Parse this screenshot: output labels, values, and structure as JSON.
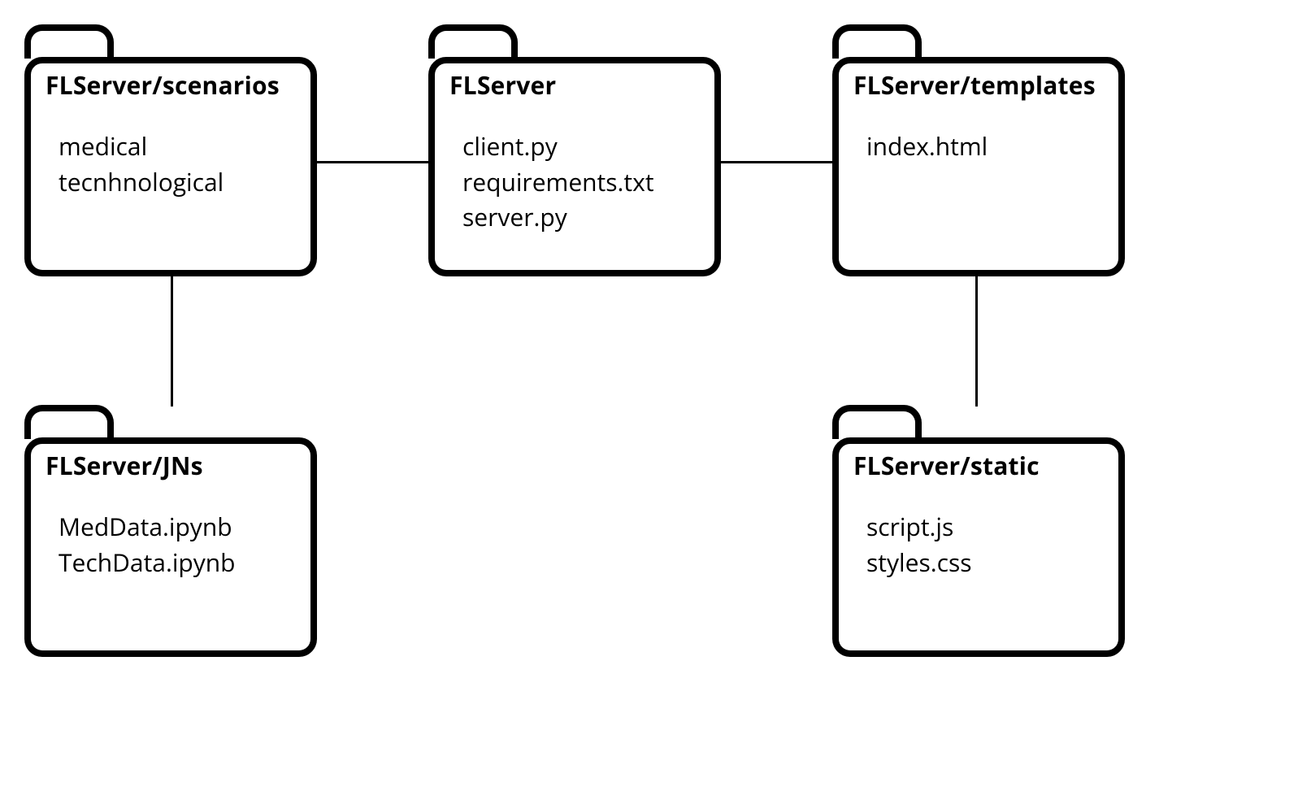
{
  "folders": {
    "scenarios": {
      "title": "FLServer/scenarios",
      "items": [
        "medical",
        "tecnhnological"
      ]
    },
    "flserver": {
      "title": "FLServer",
      "items": [
        "client.py",
        "requirements.txt",
        "server.py"
      ]
    },
    "templates": {
      "title": "FLServer/templates",
      "items": [
        "index.html"
      ]
    },
    "jns": {
      "title": "FLServer/JNs",
      "items": [
        "MedData.ipynb",
        "TechData.ipynb"
      ]
    },
    "static": {
      "title": "FLServer/static",
      "items": [
        "script.js",
        "styles.css"
      ]
    }
  },
  "edges": [
    {
      "from": "scenarios",
      "to": "flserver"
    },
    {
      "from": "flserver",
      "to": "templates"
    },
    {
      "from": "scenarios",
      "to": "jns"
    },
    {
      "from": "templates",
      "to": "static"
    }
  ]
}
